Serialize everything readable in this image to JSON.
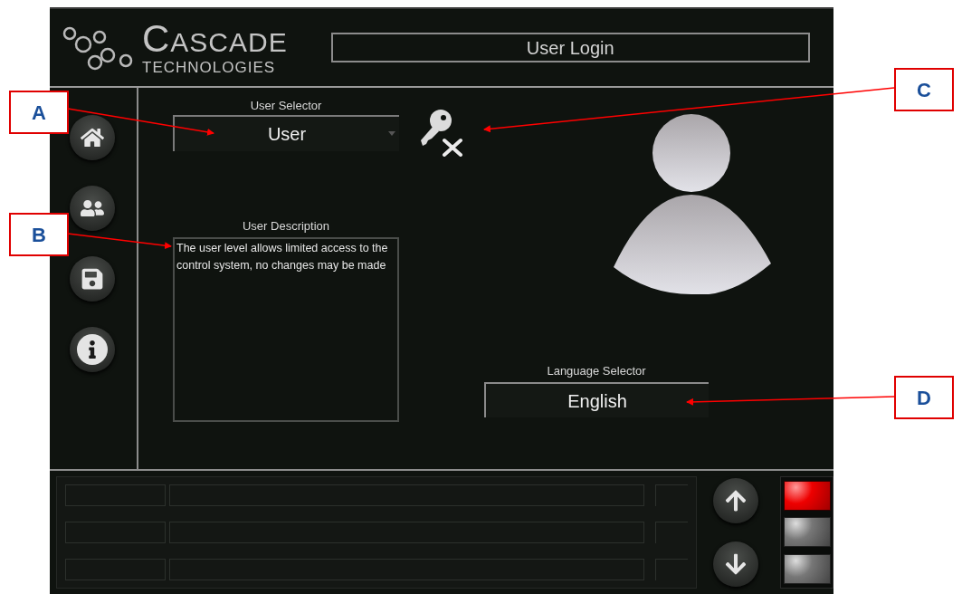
{
  "header": {
    "logo": {
      "name": "CASCADE",
      "subtitle": "TECHNOLOGIES"
    },
    "title": "User Login"
  },
  "user_selector": {
    "label": "User Selector",
    "value": "User"
  },
  "user_description": {
    "label": "User Description",
    "value": "The user level allows limited access to the control system, no changes may be made"
  },
  "language_selector": {
    "label": "Language Selector",
    "value": "English"
  },
  "status_lamps": [
    {
      "on": true
    },
    {
      "on": false
    },
    {
      "on": false
    }
  ],
  "annotations": [
    {
      "label": "A"
    },
    {
      "label": "B"
    },
    {
      "label": "C"
    },
    {
      "label": "D"
    }
  ]
}
